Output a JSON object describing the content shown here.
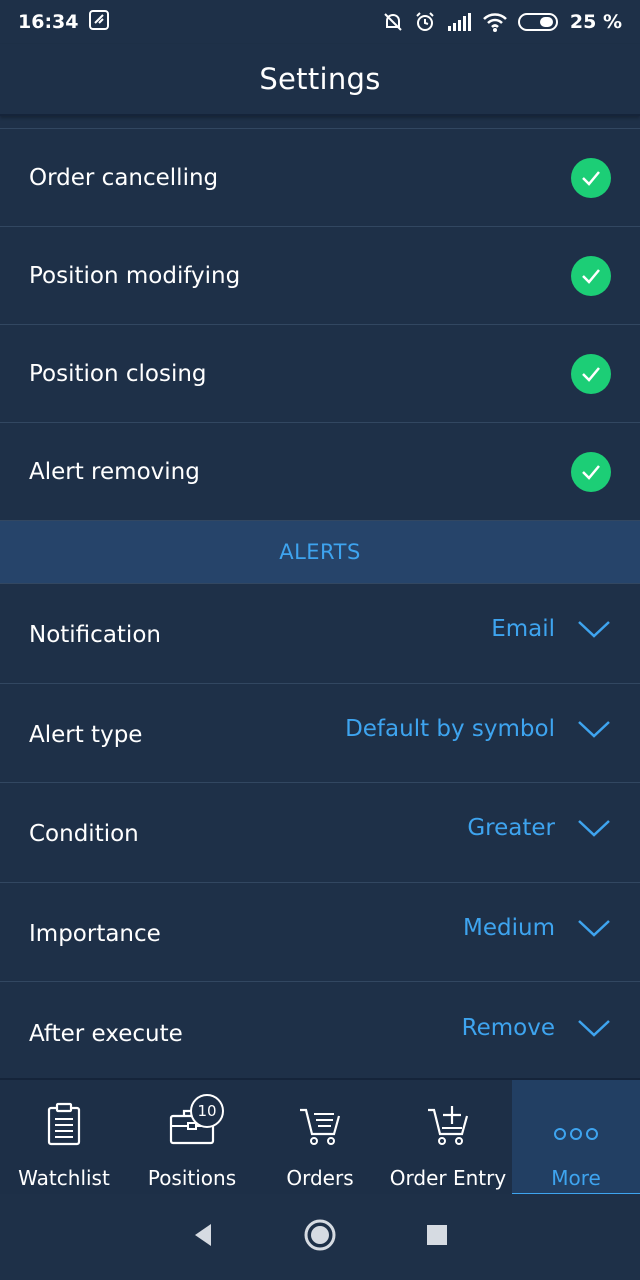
{
  "status_bar": {
    "time": "16:34",
    "battery": "25 %"
  },
  "header": {
    "title": "Settings"
  },
  "confirm_rows": [
    {
      "label": "Order cancelling",
      "checked": true
    },
    {
      "label": "Position modifying",
      "checked": true
    },
    {
      "label": "Position closing",
      "checked": true
    },
    {
      "label": "Alert removing",
      "checked": true
    }
  ],
  "alerts": {
    "section_title": "ALERTS",
    "rows": [
      {
        "label": "Notification",
        "value": "Email"
      },
      {
        "label": "Alert type",
        "value": "Default by symbol"
      },
      {
        "label": "Condition",
        "value": "Greater"
      },
      {
        "label": "Importance",
        "value": "Medium"
      },
      {
        "label": "After execute",
        "value": "Remove"
      }
    ]
  },
  "bottom_nav": {
    "items": [
      {
        "label": "Watchlist",
        "icon": "clipboard-icon"
      },
      {
        "label": "Positions",
        "icon": "briefcase-icon",
        "badge": "10"
      },
      {
        "label": "Orders",
        "icon": "cart-list-icon"
      },
      {
        "label": "Order Entry",
        "icon": "cart-plus-icon"
      },
      {
        "label": "More",
        "icon": "more-dots-icon",
        "active": true
      }
    ]
  },
  "colors": {
    "background": "#1e3048",
    "accent": "#3ea4ef",
    "check": "#1cce76",
    "section": "#26446a"
  }
}
